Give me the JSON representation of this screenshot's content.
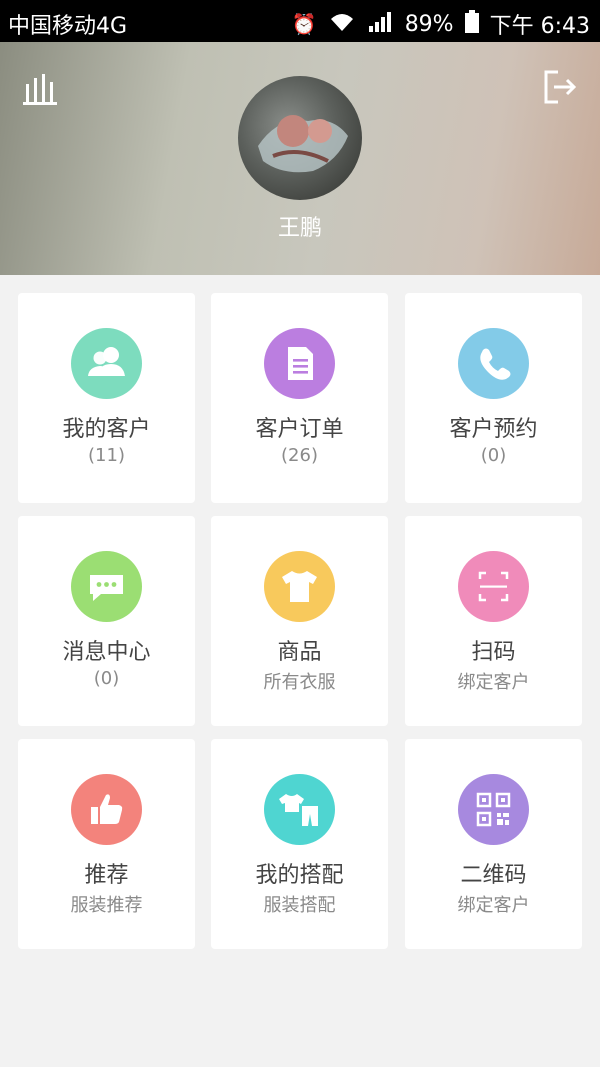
{
  "status_bar": {
    "carrier": "中国移动4G",
    "battery": "89%",
    "time": "下午 6:43"
  },
  "header": {
    "username": "王鹏"
  },
  "menu": [
    {
      "title": "我的客户",
      "sub": "(11)",
      "color": "#7ddcbe",
      "icon": "customers-icon"
    },
    {
      "title": "客户订单",
      "sub": "(26)",
      "color": "#bb7ee0",
      "icon": "order-document-icon"
    },
    {
      "title": "客户预约",
      "sub": "(0)",
      "color": "#83cbe8",
      "icon": "phone-icon"
    },
    {
      "title": "消息中心",
      "sub": "(0)",
      "color": "#9bde73",
      "icon": "message-bubble-icon"
    },
    {
      "title": "商品",
      "sub": "所有衣服",
      "color": "#f8c95c",
      "icon": "tshirt-icon"
    },
    {
      "title": "扫码",
      "sub": "绑定客户",
      "color": "#f08bba",
      "icon": "scan-icon"
    },
    {
      "title": "推荐",
      "sub": "服装推荐",
      "color": "#f3837c",
      "icon": "thumbs-up-icon"
    },
    {
      "title": "我的搭配",
      "sub": "服装搭配",
      "color": "#4fd5d1",
      "icon": "outfit-icon"
    },
    {
      "title": "二维码",
      "sub": "绑定客户",
      "color": "#a789df",
      "icon": "qr-code-icon"
    }
  ]
}
